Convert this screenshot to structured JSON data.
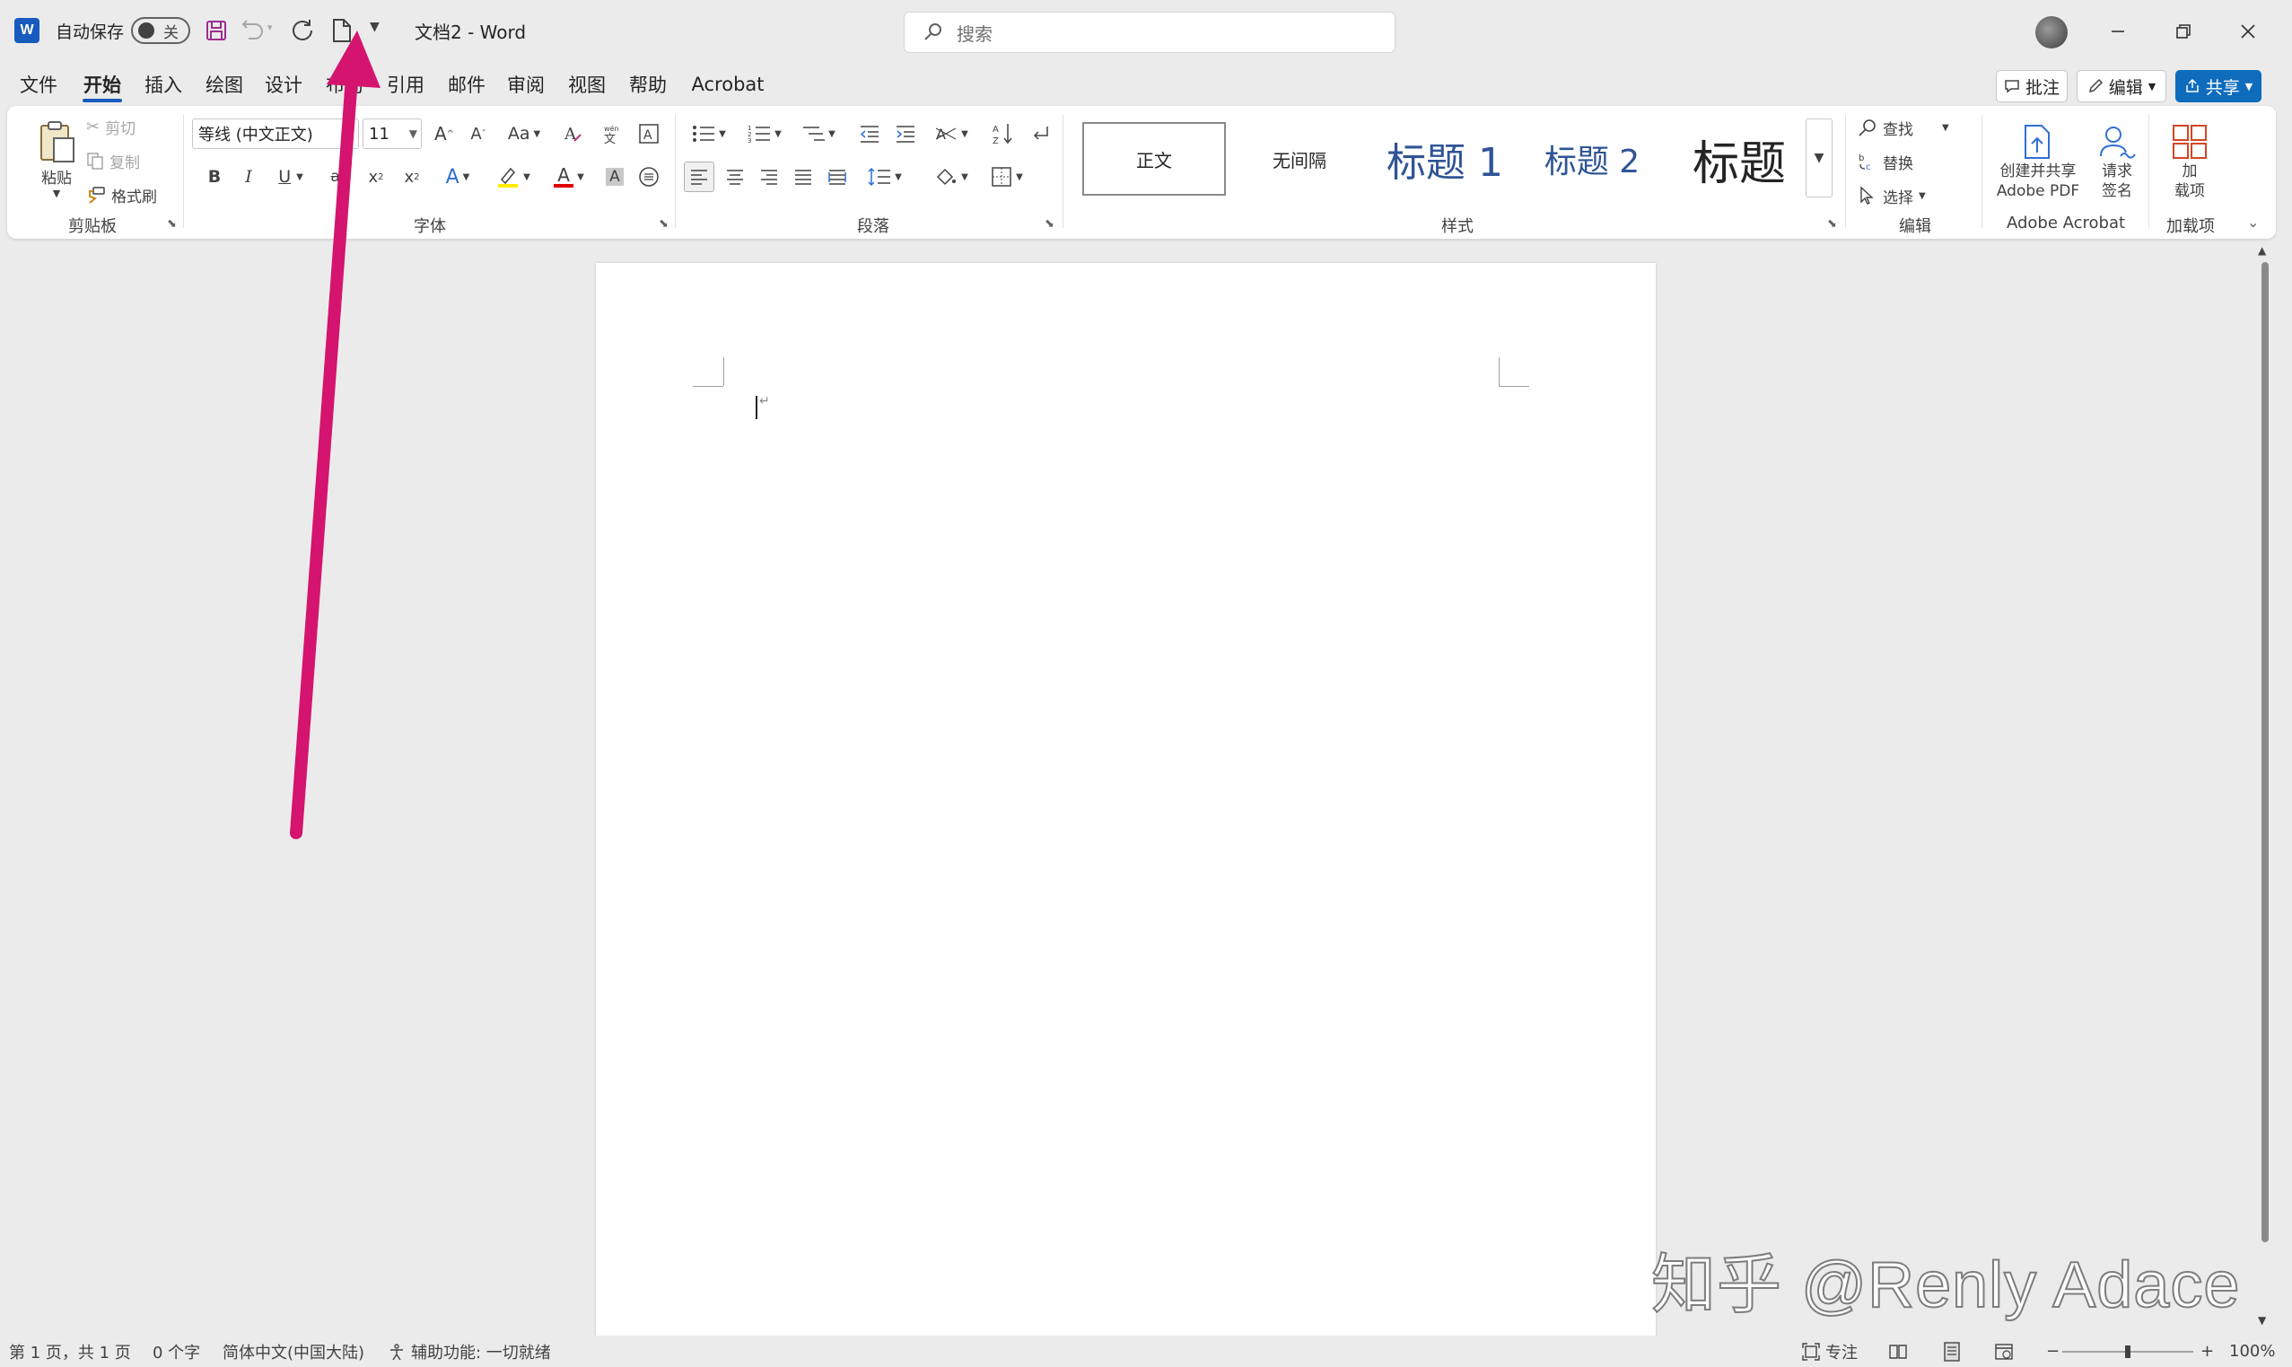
{
  "titlebar": {
    "app_logo": "W",
    "autosave_label": "自动保存",
    "autosave_state": "关",
    "doc_title": "文档2  -  Word",
    "search_placeholder": "搜索",
    "icons": [
      "save-icon",
      "undo-icon",
      "redo-icon",
      "new-document-icon",
      "customize-quick-access-icon",
      "search-icon",
      "minimize-icon",
      "restore-icon",
      "close-icon"
    ]
  },
  "tabs": {
    "items": [
      "文件",
      "开始",
      "插入",
      "绘图",
      "设计",
      "布局",
      "引用",
      "邮件",
      "审阅",
      "视图",
      "帮助",
      "Acrobat"
    ],
    "active": "开始",
    "comments": "批注",
    "editing": "编辑",
    "share": "共享"
  },
  "ribbon": {
    "clipboard": {
      "paste": "粘贴",
      "cut": "剪切",
      "copy": "复制",
      "format_painter": "格式刷",
      "group": "剪贴板"
    },
    "font": {
      "name": "等线 (中文正文)",
      "size": "11",
      "grow": "A",
      "shrink": "A",
      "case": "Aa",
      "bold": "B",
      "italic": "I",
      "underline": "U",
      "strike": "ab",
      "subscript": "x",
      "superscript": "x",
      "text_effect": "A",
      "font_color": "A",
      "shading": "A",
      "group": "字体"
    },
    "paragraph": {
      "group": "段落"
    },
    "styles": {
      "items": [
        "正文",
        "无间隔",
        "标题 1",
        "标题 2",
        "标题"
      ],
      "group": "样式"
    },
    "editing": {
      "find": "查找",
      "replace": "替换",
      "select": "选择",
      "group": "编辑"
    },
    "acrobat": {
      "create_share_line1": "创建并共享",
      "create_share_line2": "Adobe PDF",
      "request_sign_line1": "请求",
      "request_sign_line2": "签名",
      "group": "Adobe Acrobat"
    },
    "addins": {
      "label_line1": "加",
      "label_line2": "载项",
      "group": "加载项"
    }
  },
  "statusbar": {
    "page": "第 1 页，共 1 页",
    "words": "0 个字",
    "language": "简体中文(中国大陆)",
    "accessibility": "辅助功能: 一切就绪",
    "focus": "专注",
    "zoom_minus": "−",
    "zoom_plus": "+",
    "zoom": "100%",
    "zoom_level": 1.0
  },
  "watermark": "知乎 @Renly Adace",
  "colors": {
    "accent": "#185abd",
    "share": "#0f6cbd",
    "heading": "#2f5496",
    "annotation_arrow": "#d4146e",
    "app_background": "#ebebeb"
  }
}
